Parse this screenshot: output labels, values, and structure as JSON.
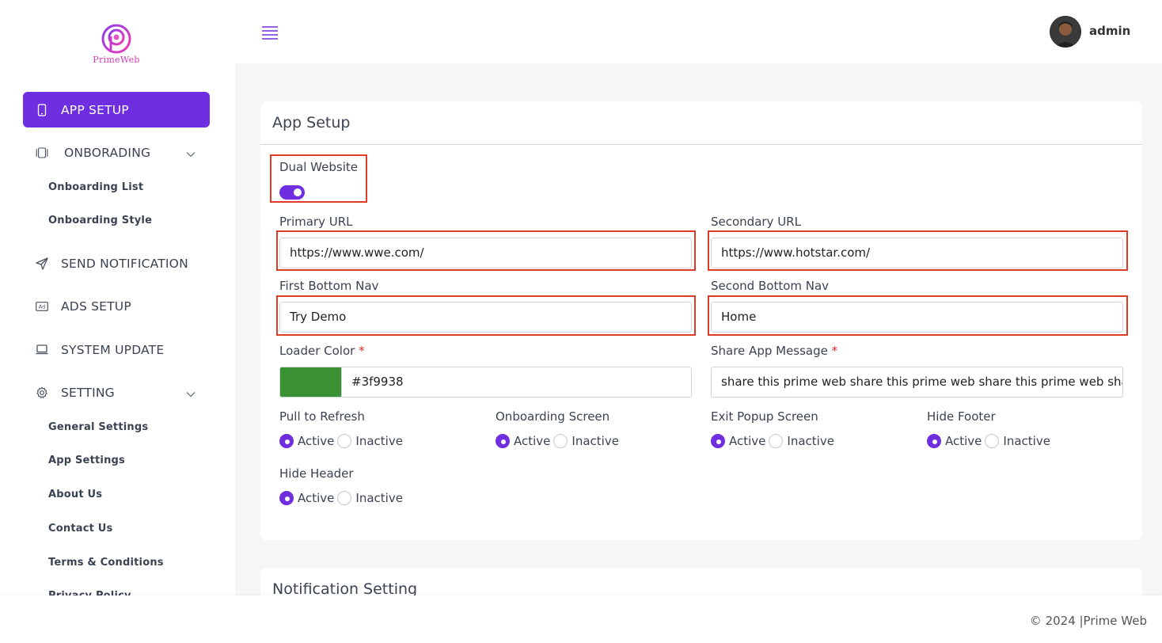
{
  "brand": {
    "name": "PrimeWeb",
    "logo_color": "#d63bb4",
    "accent": "#6f2fe0"
  },
  "sidebar": {
    "items": [
      {
        "label": "APP SETUP",
        "icon": "phone-icon",
        "active": true
      },
      {
        "label": "ONBORADING",
        "icon": "carousel-icon",
        "expandable": true
      },
      {
        "label": "SEND NOTIFICATION",
        "icon": "send-icon"
      },
      {
        "label": "ADS SETUP",
        "icon": "ad-icon"
      },
      {
        "label": "SYSTEM UPDATE",
        "icon": "laptop-icon"
      },
      {
        "label": "SETTING",
        "icon": "gear-icon",
        "expandable": true
      }
    ],
    "onboarding_sub": [
      "Onboarding List",
      "Onboarding Style"
    ],
    "setting_sub": [
      "General Settings",
      "App Settings",
      "About Us",
      "Contact Us",
      "Terms & Conditions",
      "Privacy Policy"
    ]
  },
  "header": {
    "username": "admin"
  },
  "app_setup": {
    "title": "App Setup",
    "dual_website": {
      "label": "Dual Website",
      "enabled": true
    },
    "primary_url": {
      "label": "Primary URL",
      "value": "https://www.wwe.com/"
    },
    "secondary_url": {
      "label": "Secondary URL",
      "value": "https://www.hotstar.com/"
    },
    "first_bottom_nav": {
      "label": "First Bottom Nav",
      "value": "Try Demo"
    },
    "second_bottom_nav": {
      "label": "Second Bottom Nav",
      "value": "Home"
    },
    "loader_color": {
      "label": "Loader Color",
      "required_mark": "*",
      "value": "#3f9938",
      "swatch": "#3a9134"
    },
    "share_message": {
      "label": "Share App Message",
      "required_mark": "*",
      "value": "share this prime web share this prime web share this prime web share this prime web"
    },
    "radio_active": "Active",
    "radio_inactive": "Inactive",
    "options": [
      {
        "label": "Pull to Refresh",
        "selected": "Active"
      },
      {
        "label": "Onboarding Screen",
        "selected": "Active"
      },
      {
        "label": "Exit Popup Screen",
        "selected": "Active"
      },
      {
        "label": "Hide Footer",
        "selected": "Active"
      },
      {
        "label": "Hide Header",
        "selected": "Active"
      }
    ]
  },
  "notification_setting": {
    "title": "Notification Setting"
  },
  "footer": {
    "text": "© 2024 |Prime Web"
  }
}
